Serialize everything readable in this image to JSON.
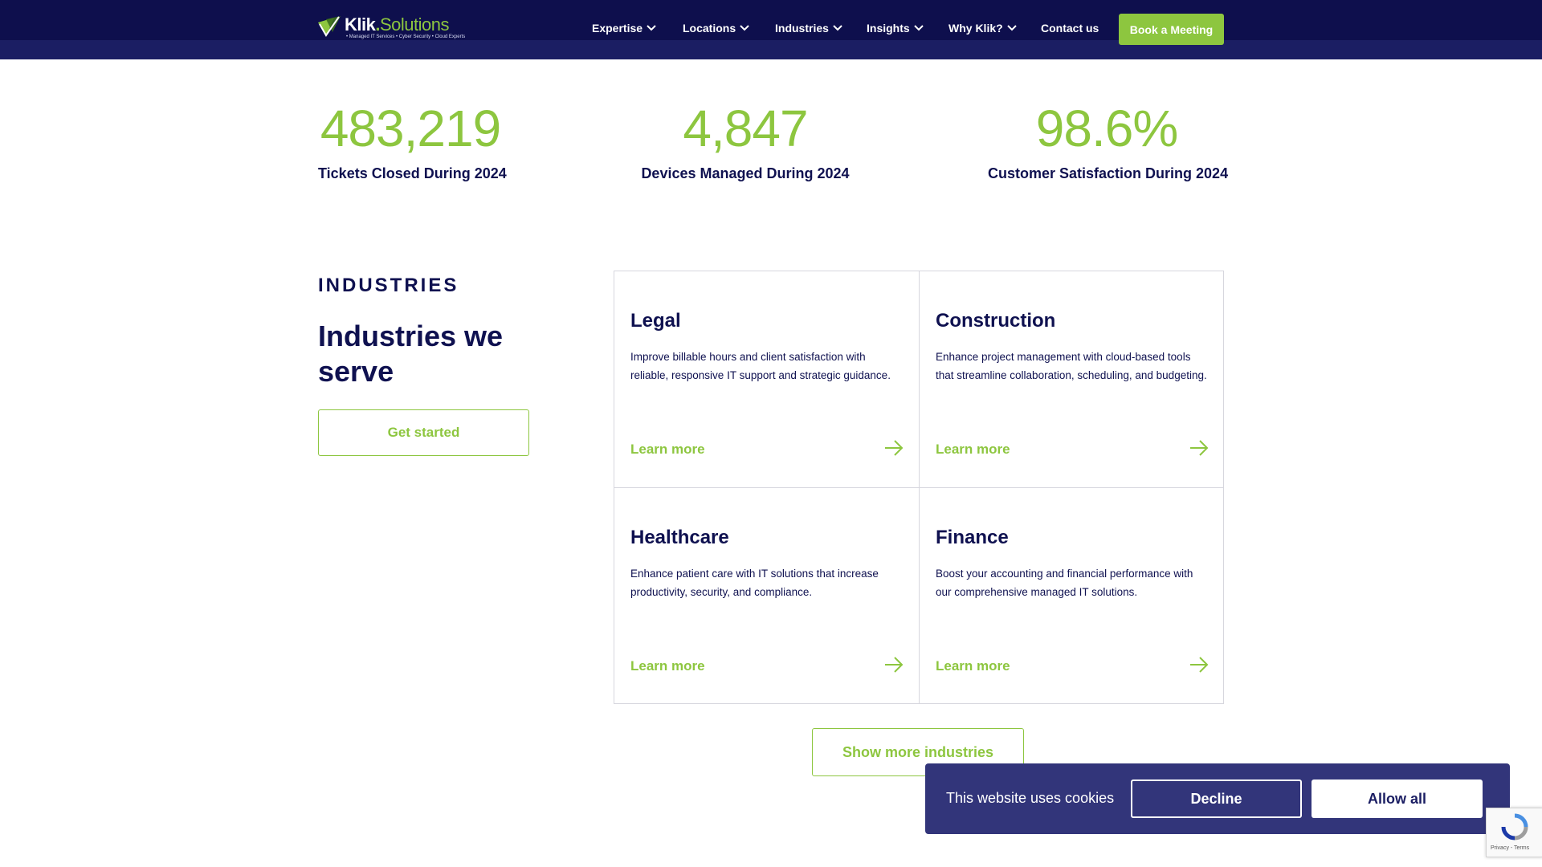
{
  "header": {
    "logo": {
      "brand_main": "Klik",
      "brand_dot": ".",
      "brand_sub": "Solutions",
      "tagline": "• Managed IT Services • Cyber Security • Cloud Experts"
    },
    "nav": [
      {
        "label": "Expertise",
        "has_dropdown": true
      },
      {
        "label": "Locations",
        "has_dropdown": true
      },
      {
        "label": "Industries",
        "has_dropdown": true
      },
      {
        "label": "Insights",
        "has_dropdown": true
      },
      {
        "label": "Why Klik?",
        "has_dropdown": true
      },
      {
        "label": "Contact us",
        "has_dropdown": false
      }
    ],
    "cta_label": "Book a Meeting"
  },
  "stats": [
    {
      "value": "483,219",
      "label": "Tickets Closed During 2024"
    },
    {
      "value": "4,847",
      "label": "Devices Managed During 2024"
    },
    {
      "value": "98.6%",
      "label": "Customer Satisfaction During 2024"
    }
  ],
  "industries": {
    "eyebrow": "INDUSTRIES",
    "title": "Industries we serve",
    "get_started_label": "Get started",
    "cards": [
      {
        "title": "Legal",
        "description": "Improve billable hours and client satisfaction with reliable, responsive IT support and strategic guidance.",
        "link_label": "Learn more"
      },
      {
        "title": "Construction",
        "description": "Enhance project management with cloud-based tools that streamline collaboration, scheduling, and budgeting.",
        "link_label": "Learn more"
      },
      {
        "title": "Healthcare",
        "description": "Enhance patient care with IT solutions that increase productivity, security, and compliance.",
        "link_label": "Learn more"
      },
      {
        "title": "Finance",
        "description": "Boost your accounting and financial performance with our comprehensive managed IT solutions.",
        "link_label": "Learn more"
      }
    ],
    "show_more_label": "Show more industries"
  },
  "cookie_banner": {
    "message": "This website uses cookies",
    "decline_label": "Decline",
    "allow_label": "Allow all"
  },
  "recaptcha": {
    "text": "Privacy - Terms"
  },
  "colors": {
    "navy": "#0e0f4d",
    "green": "#8dc63f",
    "banner": "#32357a"
  }
}
